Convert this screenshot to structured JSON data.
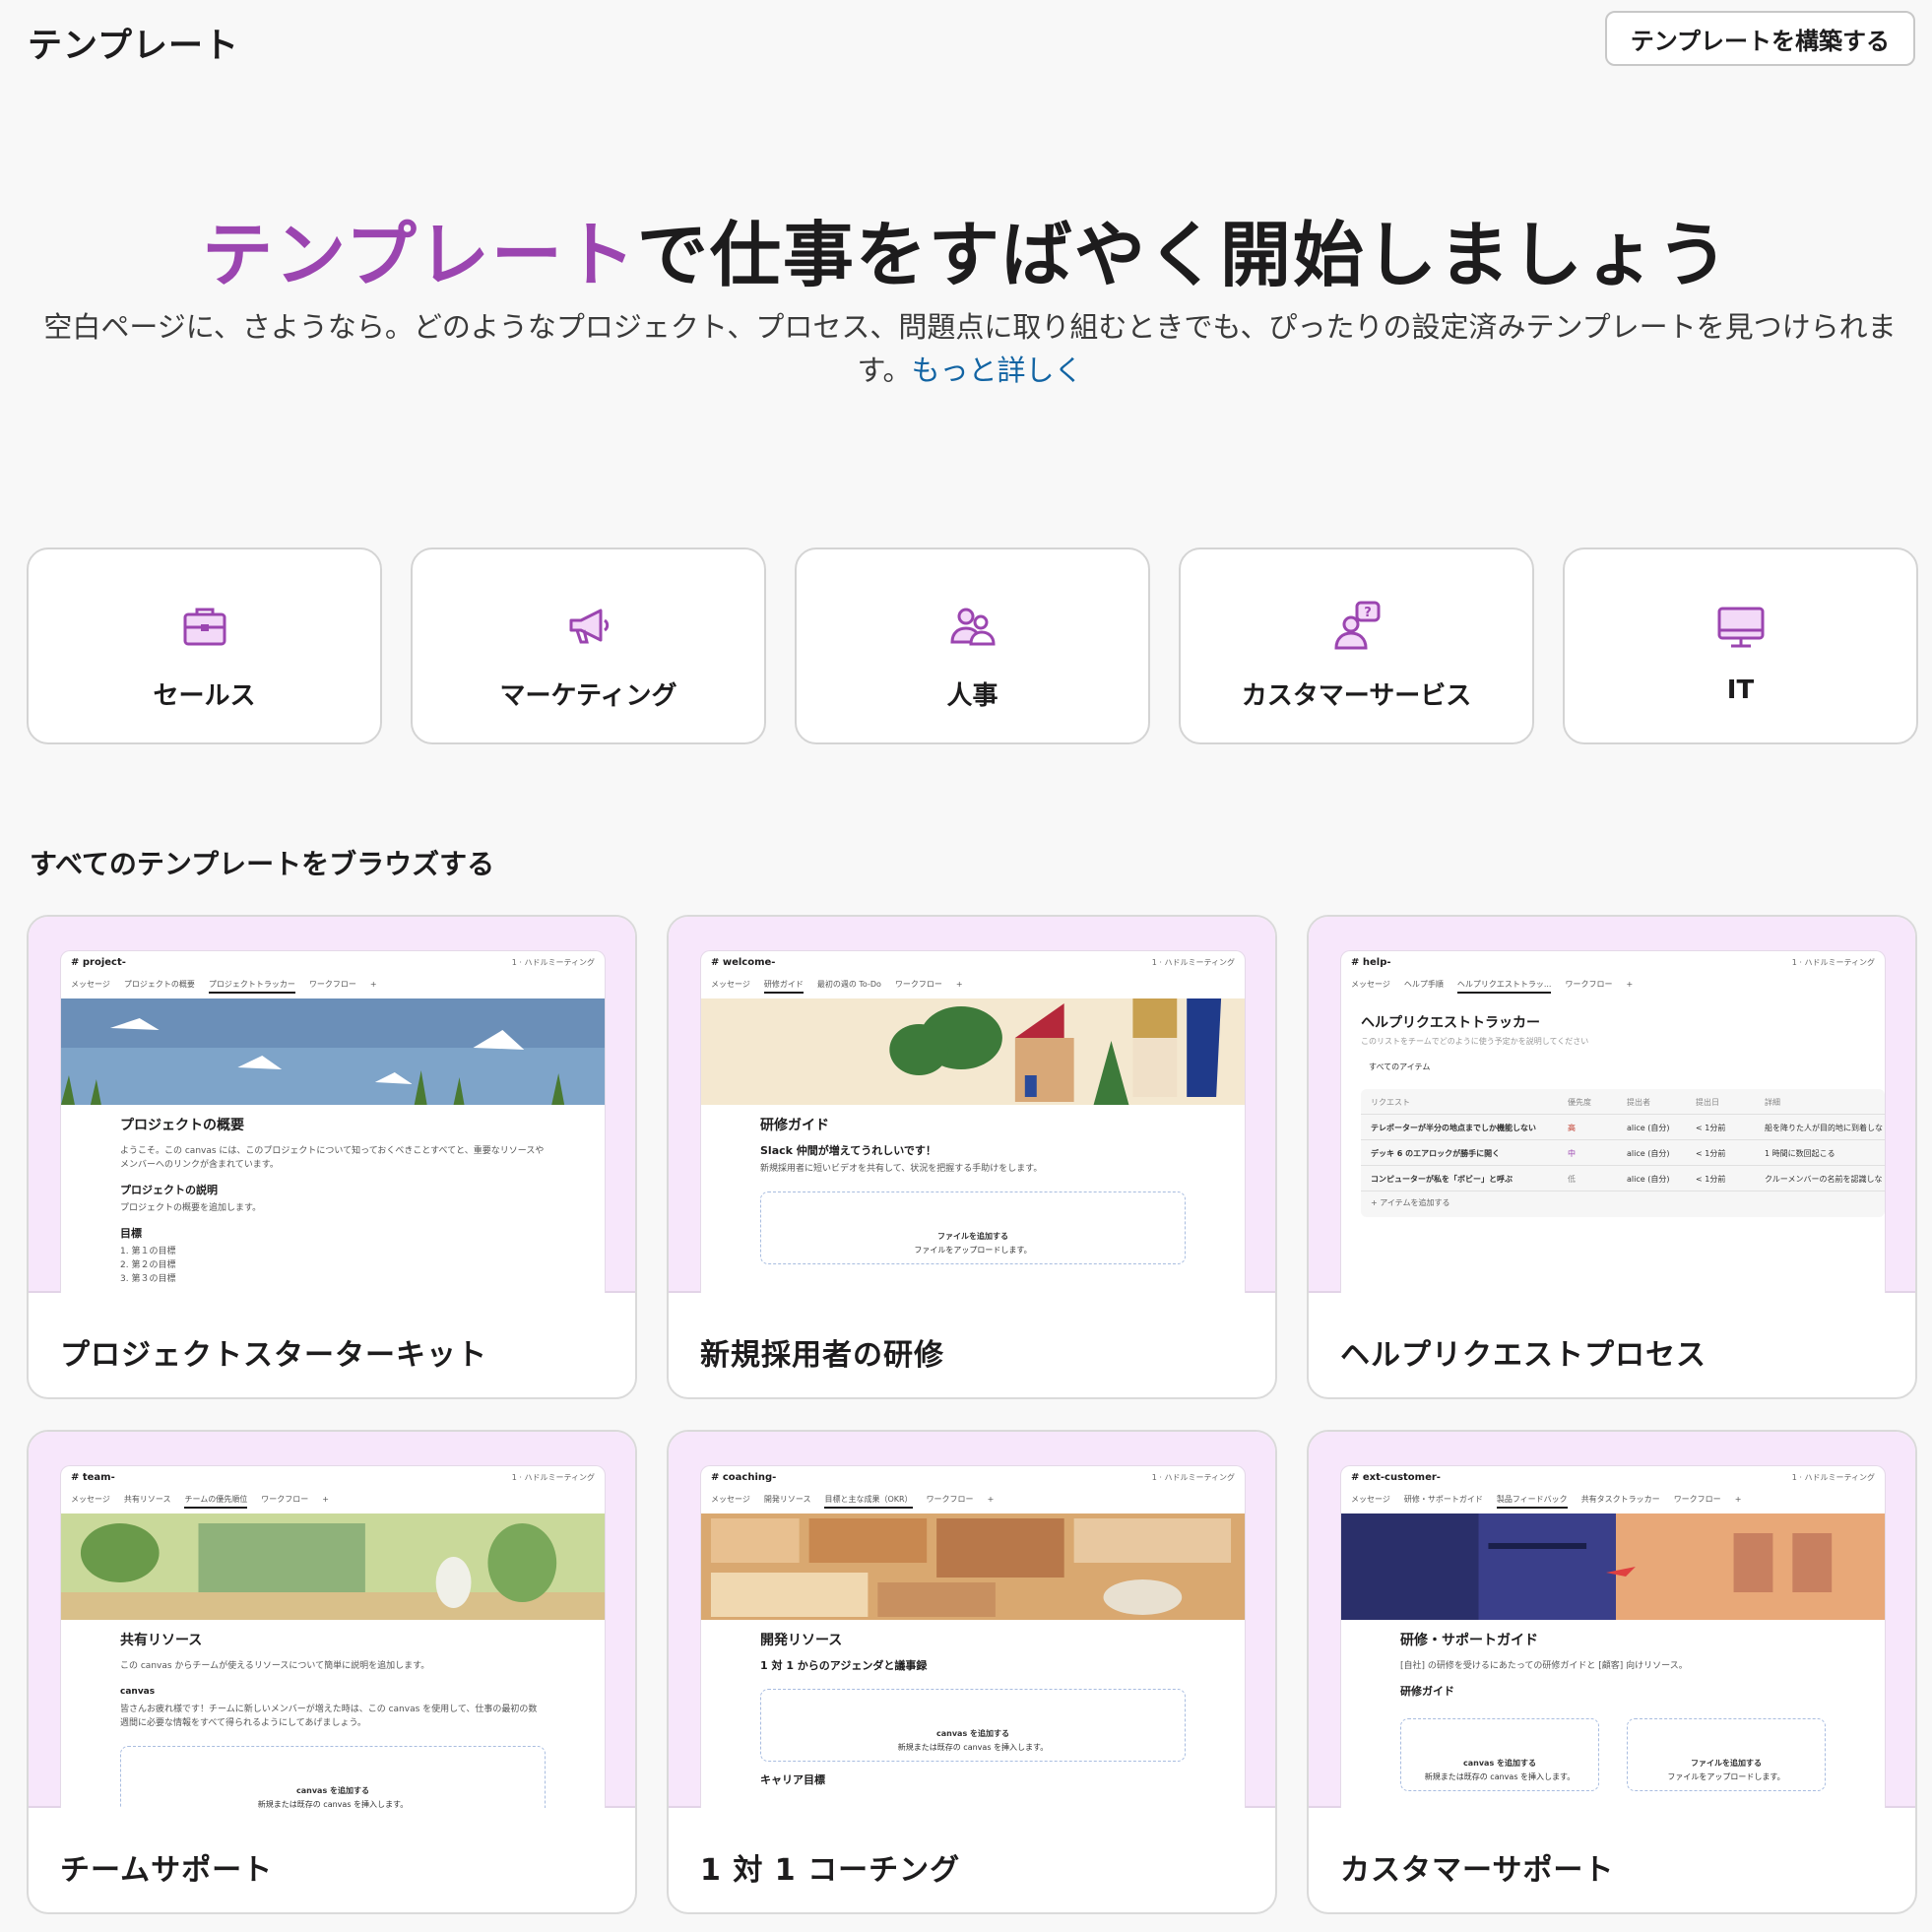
{
  "header": {
    "title": "テンプレート",
    "build_button": "テンプレートを構築する"
  },
  "hero": {
    "title_accent": "テンプレート",
    "title_rest": "で仕事をすばやく開始しましょう",
    "subtitle": "空白ページに、さようなら。どのようなプロジェクト、プロセス、問題点に取り組むときでも、ぴったりの設定済みテンプレートを見つけられます。",
    "link": "もっと詳しく"
  },
  "categories": [
    {
      "label": "セールス",
      "icon": "briefcase-icon"
    },
    {
      "label": "マーケティング",
      "icon": "megaphone-icon"
    },
    {
      "label": "人事",
      "icon": "people-icon"
    },
    {
      "label": "カスタマーサービス",
      "icon": "support-person-icon"
    },
    {
      "label": "IT",
      "icon": "monitor-icon"
    }
  ],
  "browse_title": "すべてのテンプレートをブラウズする",
  "accent_color": "#9b45b0",
  "link_color": "#1264a3",
  "templates": [
    {
      "label": "プロジェクトスターターキット",
      "channel": "# project-",
      "header_right": "1 · ハドルミーティング",
      "tabs": [
        "メッセージ",
        "プロジェクトの概要",
        "プロジェクトトラッカー",
        "ワークフロー",
        "+"
      ],
      "heading": "プロジェクトの概要",
      "text": "ようこそ。この canvas には、このプロジェクトについて知っておくべきことすべてと、重要なリソースやメンバーへのリンクが含まれています。",
      "section1": "プロジェクトの説明",
      "section1_text": "プロジェクトの概要を追加します。",
      "section2": "目標",
      "list": [
        "1. 第１の目標",
        "2. 第２の目標",
        "3. 第３の目標"
      ]
    },
    {
      "label": "新規採用者の研修",
      "channel": "# welcome-",
      "header_right": "1 · ハドルミーティング",
      "tabs": [
        "メッセージ",
        "研修ガイド",
        "最初の週の To-Do",
        "ワークフロー",
        "+"
      ],
      "heading": "研修ガイド",
      "section1": "Slack 仲間が増えてうれしいです！",
      "section1_text": "新規採用者に短いビデオを共有して、状況を把握する手助けをします。",
      "dash_title": "ファイルを追加する",
      "dash_text": "ファイルをアップロードします。"
    },
    {
      "label": "ヘルプリクエストプロセス",
      "channel": "# help-",
      "header_right": "1 · ハドルミーティング",
      "tabs": [
        "メッセージ",
        "ヘルプ手順",
        "ヘルプリクエストトラッ...",
        "ワークフロー",
        "+"
      ],
      "heading": "ヘルプリクエストトラッカー",
      "text": "このリストをチームでどのように使う予定かを説明してください",
      "filter": "すべてのアイテム",
      "columns": [
        "リクエスト",
        "優先度",
        "提出者",
        "提出日",
        "詳細"
      ],
      "rows": [
        {
          "request": "テレポーターが半分の地点までしか機能しない",
          "priority": "高",
          "by": "alice (自分)",
          "date": "< 1分前",
          "detail": "船を降りた人が目的地に到着しな"
        },
        {
          "request": "デッキ 6 のエアロックが勝手に開く",
          "priority": "中",
          "by": "alice (自分)",
          "date": "< 1分前",
          "detail": "1 時間に数回起こる"
        },
        {
          "request": "コンピューターが私を「ボビー」と呼ぶ",
          "priority": "低",
          "by": "alice (自分)",
          "date": "< 1分前",
          "detail": "クルーメンバーの名前を認識しな"
        }
      ],
      "add_item": "+ アイテムを追加する"
    },
    {
      "label": "チームサポート",
      "channel": "# team-",
      "header_right": "1 · ハドルミーティング",
      "tabs": [
        "メッセージ",
        "共有リソース",
        "チームの優先順位",
        "ワークフロー",
        "+"
      ],
      "heading": "共有リソース",
      "text": "この canvas からチームが使えるリソースについて簡単に説明を追加します。",
      "section1": "canvas",
      "section1_text": "皆さんお疲れ様です！チームに新しいメンバーが増えた時は、この canvas を使用して、仕事の最初の数週間に必要な情報をすべて得られるようにしてあげましょう。",
      "dash_title": "canvas を追加する",
      "dash_text": "新規または既存の canvas を挿入します。"
    },
    {
      "label": "1 対 1 コーチング",
      "channel": "# coaching-",
      "header_right": "1 · ハドルミーティング",
      "tabs": [
        "メッセージ",
        "開発リソース",
        "目標と主な成果（OKR）",
        "ワークフロー",
        "+"
      ],
      "heading": "開発リソース",
      "section1": "1 対 1 からのアジェンダと議事録",
      "dash_title": "canvas を追加する",
      "dash_text": "新規または既存の canvas を挿入します。",
      "section2": "キャリア目標"
    },
    {
      "label": "カスタマーサポート",
      "channel": "# ext-customer-",
      "header_right": "1 · ハドルミーティング",
      "tabs": [
        "メッセージ",
        "研修・サポートガイド",
        "製品フィードバック",
        "共有タスクトラッカー",
        "ワークフロー",
        "+"
      ],
      "heading": "研修・サポートガイド",
      "text": "[自社] の研修を受けるにあたっての研修ガイドと [顧客] 向けリソース。",
      "section1": "研修ガイド",
      "dash_title": "canvas を追加する",
      "dash_text": "新規または既存の canvas を挿入します。",
      "dash2_title": "ファイルを追加する",
      "dash2_text": "ファイルをアップロードします。"
    }
  ]
}
